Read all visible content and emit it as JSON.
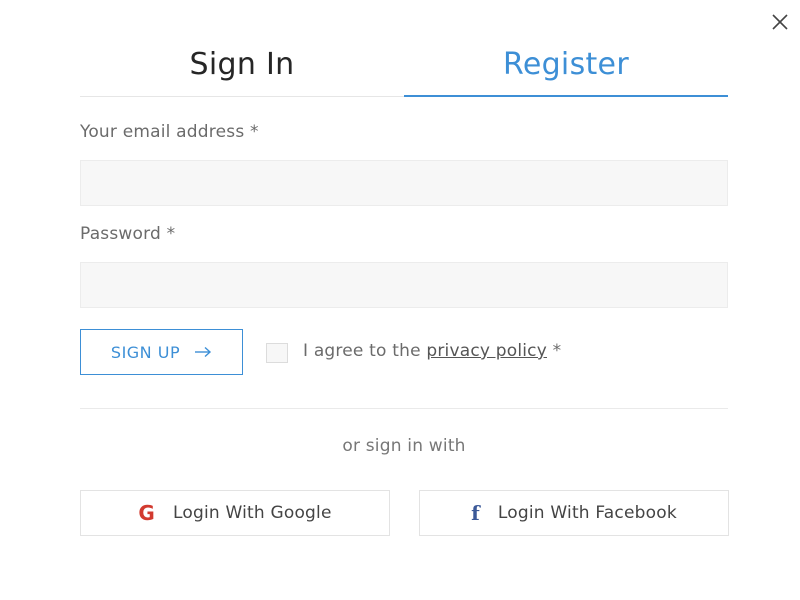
{
  "tabs": {
    "sign_in": "Sign In",
    "register": "Register",
    "active": "register"
  },
  "form": {
    "email_label": "Your email address *",
    "email_value": "",
    "password_label": "Password *",
    "password_value": "",
    "signup_label": "SIGN UP",
    "agree_prefix": "I agree to the ",
    "privacy_link": "privacy policy",
    "agree_suffix": " *",
    "agree_checked": false
  },
  "social": {
    "or_text": "or sign in with",
    "google_label": "Login With Google",
    "facebook_label": "Login With Facebook"
  },
  "colors": {
    "accent": "#3d8fd6",
    "google": "#d23a2f",
    "facebook": "#3b5998"
  },
  "icons": {
    "close": "close-icon",
    "arrow": "arrow-right-icon",
    "google": "google-icon",
    "facebook": "facebook-icon"
  }
}
